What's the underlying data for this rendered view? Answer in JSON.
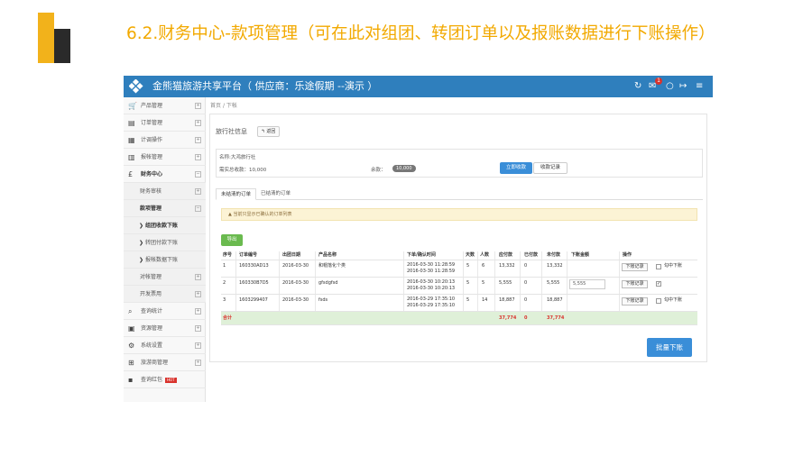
{
  "slide": {
    "title": "6.2.财务中心-款项管理（可在此对组团、转团订单以及报账数据进行下账操作）"
  },
  "app": {
    "title": "金熊猫旅游共享平台（ 供应商：乐途假期 --演示 ）",
    "notify_count": "1"
  },
  "sidebar": {
    "items": [
      {
        "icon": "cart-icon",
        "glyph": "🛒",
        "label": "产品管理",
        "toggle": "+"
      },
      {
        "icon": "order-icon",
        "glyph": "▤",
        "label": "订单管理",
        "toggle": "+"
      },
      {
        "icon": "plan-icon",
        "glyph": "▦",
        "label": "计调操作",
        "toggle": "+"
      },
      {
        "icon": "report-icon",
        "glyph": "▥",
        "label": "报帐管理",
        "toggle": "+"
      },
      {
        "icon": "pound-icon",
        "glyph": "£",
        "label": "财务中心",
        "toggle": "−"
      },
      {
        "label": "财务审核",
        "toggle": "+"
      },
      {
        "label": "款项管理",
        "toggle": "−"
      },
      {
        "label": "组团收款下账"
      },
      {
        "label": "转团付款下账"
      },
      {
        "label": "报帐数据下账"
      },
      {
        "label": "对帐管理",
        "toggle": "+"
      },
      {
        "label": "开发票用",
        "toggle": "+"
      },
      {
        "icon": "search-icon",
        "glyph": "⌕",
        "label": "查询统计",
        "toggle": "+"
      },
      {
        "icon": "resource-icon",
        "glyph": "▣",
        "label": "资源管理",
        "toggle": "+"
      },
      {
        "icon": "settings-icon",
        "glyph": "⚙",
        "label": "系统设置",
        "toggle": "+"
      },
      {
        "icon": "agency-icon",
        "glyph": "⊞",
        "label": "旅游商管理",
        "toggle": "+"
      },
      {
        "icon": "grid-icon",
        "glyph": "▪",
        "label": "查询红包",
        "hot": "HOT"
      }
    ]
  },
  "breadcrumb": {
    "home": "首页",
    "sep": "/",
    "current": "下帐"
  },
  "panel": {
    "title": "旅行社信息",
    "back_label": "返回",
    "name_label": "名称:大鸿旅行社",
    "total_label": "需实总收款：",
    "total_value": "10,000",
    "balance_label": "余款：",
    "balance_value": "10,000",
    "btn_receive": "立即收款",
    "btn_records": "收款记录"
  },
  "tabs": [
    {
      "label": "未结清的订单",
      "active": true
    },
    {
      "label": "已结清的订单",
      "active": false
    }
  ],
  "warning": "当前只显示已确认的订单列表",
  "export_label": "导出",
  "table": {
    "headers": [
      "序号",
      "订单编号",
      "出团日期",
      "产品名称",
      "下单/确认时间",
      "天数",
      "人数",
      "应付款",
      "已付款",
      "未付款",
      "下账金额",
      "操作"
    ],
    "rows": [
      {
        "no": "1",
        "order": "160330AD13",
        "date": "2016-03-30",
        "product": "和帽落化个类",
        "time1": "2016-03-30 11:28:59",
        "time2": "2016-03-30 11:28:59",
        "days": "5",
        "people": "6",
        "due": "13,332",
        "paid": "0",
        "unpaid": "13,332",
        "amount": "",
        "rec": "下账记录",
        "check": "",
        "check_label": "勾中下账"
      },
      {
        "no": "2",
        "order": "160330B7D5",
        "date": "2016-03-30",
        "product": "gfsdgfsd",
        "time1": "2016-03-30 10:20:13",
        "time2": "2016-03-30 10:20:13",
        "days": "5",
        "people": "5",
        "due": "5,555",
        "paid": "0",
        "unpaid": "5,555",
        "amount": "5,555",
        "rec": "下账记录",
        "check": "✓",
        "check_label": ""
      },
      {
        "no": "3",
        "order": "1603299407",
        "date": "2016-03-30",
        "product": "fsds",
        "time1": "2016-03-29 17:35:10",
        "time2": "2016-03-29 17:35:10",
        "days": "5",
        "people": "14",
        "due": "18,887",
        "paid": "0",
        "unpaid": "18,887",
        "amount": "",
        "rec": "下账记录",
        "check": "",
        "check_label": "勾中下账"
      }
    ],
    "total": {
      "label": "合计",
      "due": "37,774",
      "paid": "0",
      "unpaid": "37,774"
    }
  },
  "batch_label": "批量下账"
}
